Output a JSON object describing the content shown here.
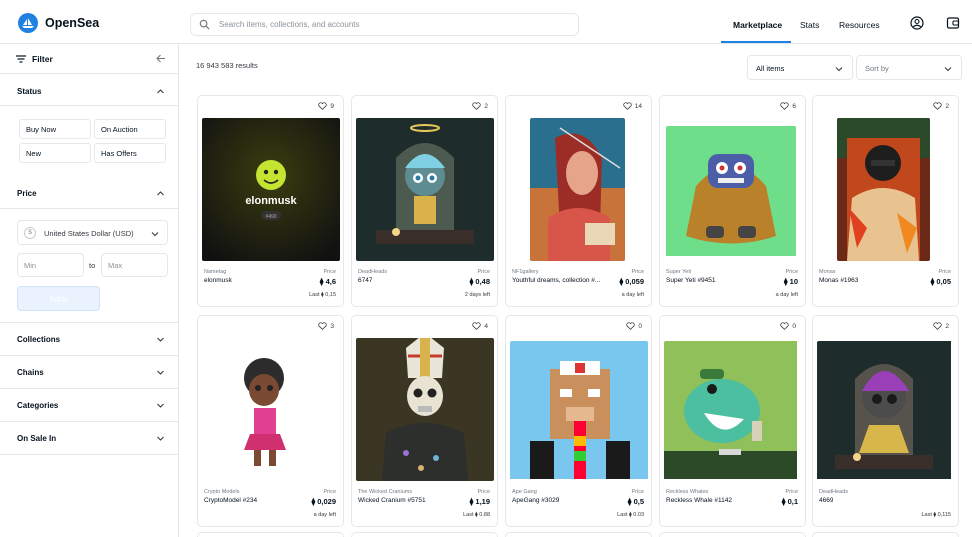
{
  "header": {
    "brand": "OpenSea",
    "search_placeholder": "Search items, collections, and accounts",
    "nav": [
      "Marketplace",
      "Stats",
      "Resources"
    ]
  },
  "sidebar": {
    "filter_label": "Filter",
    "status": {
      "title": "Status",
      "options": [
        "Buy Now",
        "On Auction",
        "New",
        "Has Offers"
      ]
    },
    "price": {
      "title": "Price",
      "currency": "United States Dollar (USD)",
      "min_placeholder": "Min",
      "to_label": "to",
      "max_placeholder": "Max",
      "apply_label": "Apply"
    },
    "sections": [
      "Collections",
      "Chains",
      "Categories",
      "On Sale In"
    ]
  },
  "main": {
    "results": "16 943 583 results",
    "items_filter": "All items",
    "sort_placeholder": "Sort by",
    "cards": [
      {
        "likes": "9",
        "collection": "Nametag",
        "name": "elonmusk",
        "price_label": "Price",
        "price": "4,6",
        "foot": "Last ⧫ 0,15",
        "art_title": "elonmusk",
        "art_badge": "#490"
      },
      {
        "likes": "2",
        "collection": "DeadHeads",
        "name": "6747",
        "price_label": "Price",
        "price": "0,48",
        "foot": "2 days left"
      },
      {
        "likes": "14",
        "collection": "NF1gallery",
        "name": "Youthful dreams, collection #...",
        "price_label": "Price",
        "price": "0,059",
        "foot": "a day left"
      },
      {
        "likes": "6",
        "collection": "Super Yeti",
        "name": "Super Yeti #9451",
        "price_label": "Price",
        "price": "10",
        "foot": "a day left"
      },
      {
        "likes": "2",
        "collection": "Monas",
        "name": "Monas #1963",
        "price_label": "Price",
        "price": "0,05",
        "foot": ""
      },
      {
        "likes": "3",
        "collection": "Crypto Models",
        "name": "CryptoModel #234",
        "price_label": "Price",
        "price": "0,029",
        "foot": "a day left"
      },
      {
        "likes": "4",
        "collection": "The Wicked Craniums",
        "name": "Wicked Cranium #5751",
        "price_label": "Price",
        "price": "1,19",
        "foot": "Last ⧫ 0.88"
      },
      {
        "likes": "0",
        "collection": "Ape Gang",
        "name": "ApeGang #3029",
        "price_label": "Price",
        "price": "0,5",
        "foot": "Last ⧫ 0.03"
      },
      {
        "likes": "0",
        "collection": "Reckless Whales",
        "name": "Reckless Whale #1142",
        "price_label": "Price",
        "price": "0,1",
        "foot": ""
      },
      {
        "likes": "2",
        "collection": "DeadHeads",
        "name": "4669",
        "price_label": "",
        "price": "",
        "foot": "Last ⧫ 0,115"
      }
    ]
  },
  "colors": {
    "brand": "#2081e2",
    "border": "#e5e8eb",
    "text": "#04111d",
    "muted": "#707a83"
  }
}
